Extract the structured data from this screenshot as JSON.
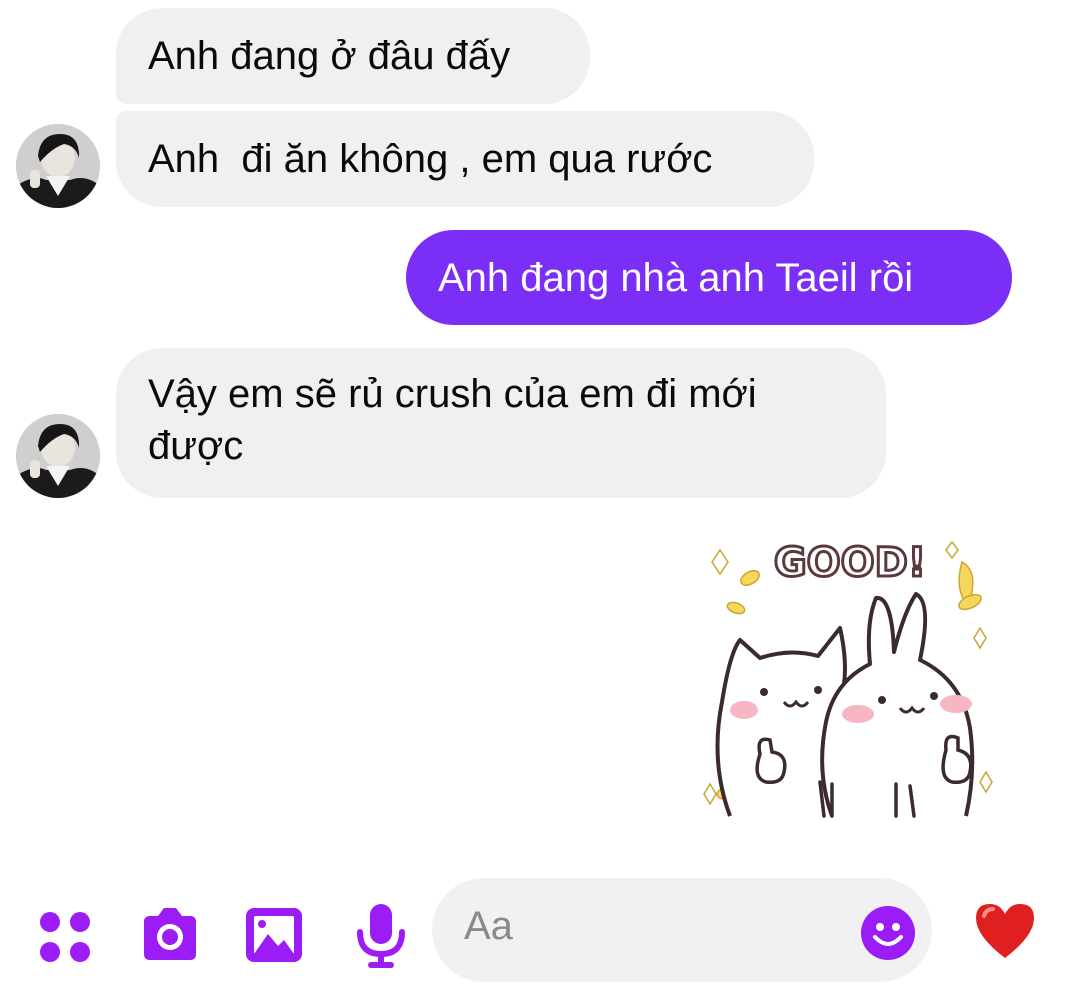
{
  "conversation": {
    "messages": [
      {
        "direction": "incoming",
        "text": "Anh đang ở đâu đấy"
      },
      {
        "direction": "incoming",
        "text": "Anh  đi ăn không , em qua rước"
      },
      {
        "direction": "outgoing",
        "text": "Anh đang nhà anh Taeil rồi"
      },
      {
        "direction": "incoming",
        "text": "Vậy em sẽ rủ crush của em đi mới được"
      }
    ],
    "sticker": {
      "text": "GOOD!"
    }
  },
  "composer": {
    "placeholder": "Aa"
  },
  "colors": {
    "accent": "#7b2ef5",
    "incoming_bubble": "#f0f0f0",
    "heart": "#e02020"
  }
}
